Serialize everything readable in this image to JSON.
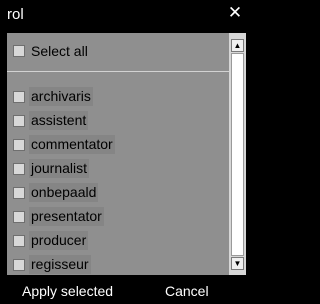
{
  "window": {
    "title": "rol",
    "close_glyph": "✕"
  },
  "select_all": {
    "label": "Select all",
    "checked": false
  },
  "items": [
    {
      "label": "archivaris",
      "checked": false
    },
    {
      "label": "assistent",
      "checked": false
    },
    {
      "label": "commentator",
      "checked": false
    },
    {
      "label": "journalist",
      "checked": false
    },
    {
      "label": "onbepaald",
      "checked": false
    },
    {
      "label": "presentator",
      "checked": false
    },
    {
      "label": "producer",
      "checked": false
    },
    {
      "label": "regisseur",
      "checked": false
    }
  ],
  "scrollbar": {
    "up_glyph": "▲",
    "down_glyph": "▼"
  },
  "footer": {
    "apply_label": "Apply selected",
    "cancel_label": "Cancel"
  },
  "colors": {
    "background": "#000000",
    "panel": "#8f8f8f",
    "scroll_track": "#ffffff",
    "text_light": "#ffffff",
    "text_dark": "#000000"
  }
}
